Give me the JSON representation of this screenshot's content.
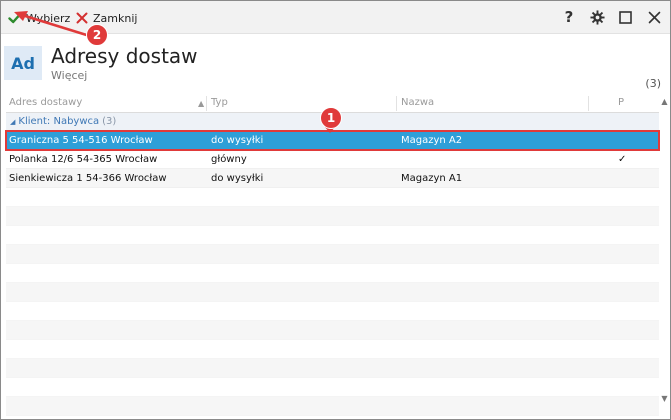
{
  "toolbar": {
    "select_label": "Wybierz",
    "close_label": "Zamknij",
    "help_label": "?"
  },
  "header": {
    "avatar": "Ad",
    "title": "Adresy dostaw",
    "more": "Więcej",
    "count": "(3)"
  },
  "columns": {
    "address": "Adres dostawy",
    "type": "Typ",
    "name": "Nazwa",
    "p": "P"
  },
  "group": {
    "label": "Klient: Nabywca",
    "count": "(3)"
  },
  "rows": [
    {
      "address": "Graniczna 5 54-516 Wrocław",
      "type": "do wysyłki",
      "name": "Magazyn A2",
      "p": ""
    },
    {
      "address": "Polanka  12/6  54-365 Wrocław",
      "type": "główny",
      "name": "",
      "p": "✓"
    },
    {
      "address": "Sienkiewicza 1 54-366 Wrocław",
      "type": "do wysyłki",
      "name": "Magazyn A1",
      "p": ""
    }
  ],
  "annotations": {
    "badge_1": "1",
    "badge_2": "2",
    "color": "#e03a3a"
  },
  "colors": {
    "selected_row": "#2e9fd8",
    "accent_blue": "#1d6fb0",
    "check_green": "#2e8b2e",
    "close_red": "#d33030"
  }
}
